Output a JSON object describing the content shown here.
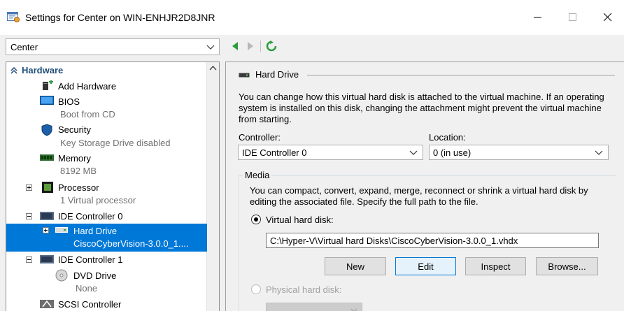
{
  "window": {
    "title": "Settings for Center on WIN-ENHJR2D8JNR"
  },
  "vm_selector": {
    "value": "Center"
  },
  "tree": {
    "section_label": "Hardware",
    "items": [
      {
        "label": "Add Hardware",
        "sub": ""
      },
      {
        "label": "BIOS",
        "sub": "Boot from CD"
      },
      {
        "label": "Security",
        "sub": "Key Storage Drive disabled"
      },
      {
        "label": "Memory",
        "sub": "8192 MB"
      },
      {
        "label": "Processor",
        "sub": "1 Virtual processor"
      },
      {
        "label": "IDE Controller 0",
        "sub": ""
      },
      {
        "label": "Hard Drive",
        "sub": "CiscoCyberVision-3.0.0_1...."
      },
      {
        "label": "IDE Controller 1",
        "sub": ""
      },
      {
        "label": "DVD Drive",
        "sub": "None"
      },
      {
        "label": "SCSI Controller",
        "sub": ""
      }
    ]
  },
  "panel": {
    "heading": "Hard Drive",
    "description": "You can change how this virtual hard disk is attached to the virtual machine. If an operating system is installed on this disk, changing the attachment might prevent the virtual machine from starting.",
    "controller_label": "Controller:",
    "controller_value": "IDE Controller 0",
    "location_label": "Location:",
    "location_value": "0 (in use)",
    "media_label": "Media",
    "media_description": "You can compact, convert, expand, merge, reconnect or shrink a virtual hard disk by editing the associated file. Specify the full path to the file.",
    "vhd_radio_label": "Virtual hard disk:",
    "vhd_path": "C:\\Hyper-V\\Virtual hard Disks\\CiscoCyberVision-3.0.0_1.vhdx",
    "buttons": {
      "new": "New",
      "edit": "Edit",
      "inspect": "Inspect",
      "browse": "Browse..."
    },
    "physical_radio_label": "Physical hard disk:"
  },
  "colors": {
    "selection": "#0078d7",
    "nav_green": "#2a9d3c",
    "header_blue": "#1f4e79"
  }
}
